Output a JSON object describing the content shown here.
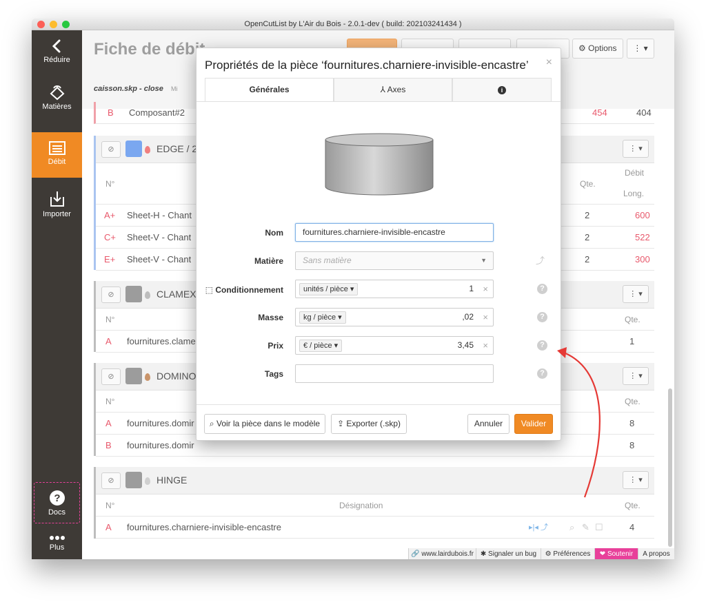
{
  "window": {
    "title": "OpenCutList by L'Air du Bois - 2.0.1-dev ( build: 202103241434 )"
  },
  "sidebar": {
    "items": [
      {
        "label": "Réduire",
        "icon": "chevron-left-icon"
      },
      {
        "label": "Matières",
        "icon": "materials-icon"
      },
      {
        "label": "Débit",
        "icon": "cutlist-icon"
      },
      {
        "label": "Importer",
        "icon": "import-icon"
      },
      {
        "label": "Docs",
        "icon": "question-icon"
      },
      {
        "label": "Plus",
        "icon": "more-icon"
      }
    ]
  },
  "header": {
    "title": "Fiche de débit",
    "buttons": {
      "options": "Options"
    },
    "file_tab": "caisson.skp - close",
    "file_tab_extra": "Mi"
  },
  "blocks": [
    {
      "name": "EDGE / 2",
      "col_num": "N°",
      "col_qty": "Qte.",
      "col_debit": "Débit",
      "col_long": "Long.",
      "rows": [
        {
          "num": "A+",
          "name": "Sheet-H - Chant",
          "qty": "2",
          "long": "600"
        },
        {
          "num": "C+",
          "name": "Sheet-V - Chant",
          "qty": "2",
          "long": "522"
        },
        {
          "num": "E+",
          "name": "Sheet-V - Chant",
          "qty": "2",
          "long": "300"
        }
      ]
    },
    {
      "name": "CLAMEX",
      "col_num": "N°",
      "col_qty": "Qte.",
      "rows": [
        {
          "num": "A",
          "name": "fournitures.clame",
          "qty": "1"
        }
      ]
    },
    {
      "name": "DOMINO",
      "col_num": "N°",
      "col_qty": "Qte.",
      "rows": [
        {
          "num": "A",
          "name": "fournitures.domir",
          "qty": "8"
        },
        {
          "num": "B",
          "name": "fournitures.domir",
          "qty": "8"
        }
      ]
    },
    {
      "name": "HINGE",
      "col_num": "N°",
      "col_designation": "Désignation",
      "col_qty": "Qte.",
      "rows": [
        {
          "num": "A",
          "name": "fournitures.charniere-invisible-encastre",
          "qty": "4"
        }
      ]
    }
  ],
  "top_row": {
    "num": "B",
    "name": "Composant#2",
    "val1": "454",
    "val2": "404"
  },
  "footer": {
    "website": "www.lairdubois.fr",
    "bug": "Signaler un bug",
    "prefs": "Préférences",
    "support": "Soutenir",
    "about": "A propos"
  },
  "modal": {
    "title": "Propriétés de la pièce ‘fournitures.charniere-invisible-encastre’",
    "close": "×",
    "tabs": [
      {
        "label": "Générales",
        "active": true
      },
      {
        "label": "Axes",
        "active": false
      },
      {
        "label": "",
        "active": false
      }
    ],
    "fields": {
      "nom_label": "Nom",
      "nom_value": "fournitures.charniere-invisible-encastre",
      "matiere_label": "Matière",
      "matiere_placeholder": "Sans matière",
      "cond_label": "Conditionnement",
      "cond_unit": "unités / pièce",
      "cond_value": "1",
      "masse_label": "Masse",
      "masse_unit": "kg / pièce",
      "masse_value": ",02",
      "prix_label": "Prix",
      "prix_unit": "€ / pièce",
      "prix_value": "3,45",
      "tags_label": "Tags"
    },
    "buttons": {
      "view": "Voir la pièce dans le modèle",
      "export": "Exporter (.skp)",
      "cancel": "Annuler",
      "validate": "Valider"
    }
  },
  "colors": {
    "accent": "#f08a24",
    "sidebar": "#3e3a36",
    "support": "#e8409a",
    "number": "#e8586b",
    "arrow": "#e53935"
  }
}
